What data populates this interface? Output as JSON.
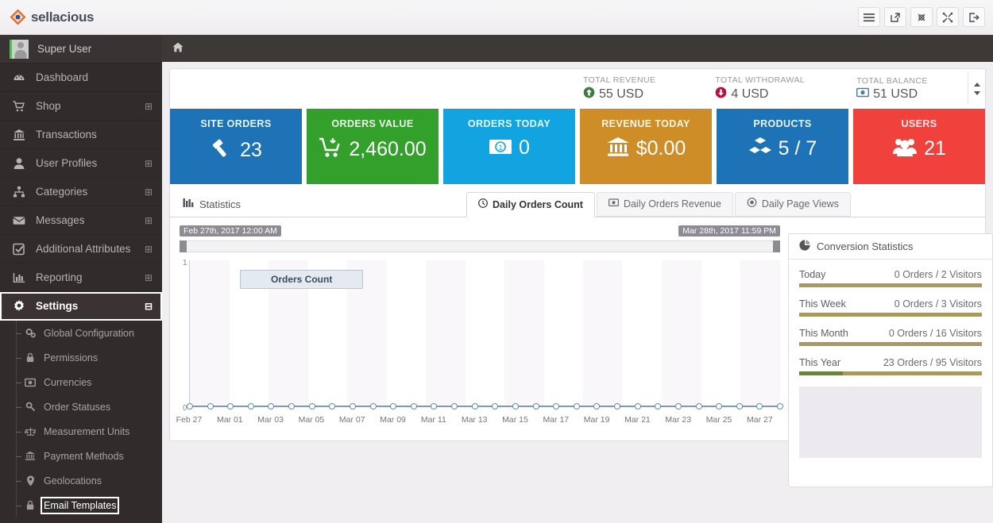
{
  "brand": {
    "name": "sellacious"
  },
  "topbar": {
    "icons": [
      {
        "name": "menu-toggle-icon",
        "glyph": "☰"
      },
      {
        "name": "preview-site-icon",
        "glyph": "↗"
      },
      {
        "name": "joomla-icon",
        "glyph": "❉"
      },
      {
        "name": "fullscreen-icon",
        "glyph": "⤢"
      },
      {
        "name": "logout-icon",
        "glyph": "→"
      }
    ]
  },
  "sidebar": {
    "user": "Super User",
    "items": [
      {
        "label": "Dashboard",
        "icon": "dashboard-icon",
        "expand": ""
      },
      {
        "label": "Shop",
        "icon": "cart-icon",
        "expand": "⊞"
      },
      {
        "label": "Transactions",
        "icon": "bank-icon",
        "expand": ""
      },
      {
        "label": "User Profiles",
        "icon": "user-icon",
        "expand": "⊞"
      },
      {
        "label": "Categories",
        "icon": "sitemap-icon",
        "expand": "⊞"
      },
      {
        "label": "Messages",
        "icon": "envelope-icon",
        "expand": "⊞"
      },
      {
        "label": "Additional Attributes",
        "icon": "checkbox-icon",
        "expand": "⊞"
      },
      {
        "label": "Reporting",
        "icon": "bar-chart-icon",
        "expand": "⊞"
      },
      {
        "label": "Settings",
        "icon": "gear-icon",
        "expand": "⊟",
        "active": true
      }
    ],
    "subitems": [
      {
        "label": "Global Configuration",
        "icon": "gears-icon"
      },
      {
        "label": "Permissions",
        "icon": "lock-icon"
      },
      {
        "label": "Currencies",
        "icon": "money-icon"
      },
      {
        "label": "Order Statuses",
        "icon": "wrench-icon"
      },
      {
        "label": "Measurement Units",
        "icon": "balance-scale-icon"
      },
      {
        "label": "Payment Methods",
        "icon": "bank-icon"
      },
      {
        "label": "Geolocations",
        "icon": "map-marker-icon"
      },
      {
        "label": "Email Templates",
        "icon": "lock-icon",
        "selected": true
      }
    ]
  },
  "breadcrumb": {
    "home_icon": "home-icon"
  },
  "summary": [
    {
      "label": "TOTAL REVENUE",
      "value": "55 USD",
      "icon": "arrow-up-circle-icon",
      "icon_color": "#3f7d3f"
    },
    {
      "label": "TOTAL WITHDRAWAL",
      "value": "4 USD",
      "icon": "arrow-down-circle-icon",
      "icon_color": "#b5123c"
    },
    {
      "label": "TOTAL BALANCE",
      "value": "51 USD",
      "icon": "money-icon",
      "icon_color": "#4a7fa5"
    }
  ],
  "summary_scroll_icon": "sort-updown-icon",
  "cards": [
    {
      "title": "SITE ORDERS",
      "value": "23",
      "icon": "gavel-icon",
      "glyph": "🔨",
      "color": "#1e73b7"
    },
    {
      "title": "ORDERS VALUE",
      "value": "2,460.00",
      "icon": "cart-arrow-down-icon",
      "glyph": "🛒",
      "color": "#33a02c"
    },
    {
      "title": "ORDERS TODAY",
      "value": "0",
      "icon": "money-bill-icon",
      "glyph": "💵",
      "color": "#12a4e0"
    },
    {
      "title": "REVENUE TODAY",
      "value": "$0.00",
      "icon": "bank-icon",
      "glyph": "🏛",
      "color": "#ce8d26"
    },
    {
      "title": "PRODUCTS",
      "value": "5 / 7",
      "icon": "cubes-icon",
      "glyph": "◧",
      "color": "#1e73b7"
    },
    {
      "title": "USERS",
      "value": "21",
      "icon": "users-icon",
      "glyph": "👥",
      "color": "#f0413c"
    }
  ],
  "statistics": {
    "panel_title": "Statistics",
    "panel_icon": "bar-chart-icon",
    "tabs": [
      {
        "label": "Daily Orders Count",
        "icon": "clock-icon",
        "active": true
      },
      {
        "label": "Daily Orders Revenue",
        "icon": "money-icon",
        "active": false
      },
      {
        "label": "Daily Page Views",
        "icon": "eye-icon",
        "active": false
      }
    ],
    "range_start": "Feb 27th, 2017 12:00 AM",
    "range_end": "Mar 28th, 2017 11:59 PM"
  },
  "chart_data": {
    "type": "line",
    "title": "",
    "legend": [
      "Orders Count"
    ],
    "legend_position": "inside-top-left",
    "xlabel": "",
    "ylabel": "",
    "ylim": [
      0,
      1
    ],
    "ytick_labels": [
      "1",
      "0"
    ],
    "grid": "alternating-vertical-bands",
    "x": [
      "Feb 27",
      "Feb 28",
      "Mar 01",
      "Mar 02",
      "Mar 03",
      "Mar 04",
      "Mar 05",
      "Mar 06",
      "Mar 07",
      "Mar 08",
      "Mar 09",
      "Mar 10",
      "Mar 11",
      "Mar 12",
      "Mar 13",
      "Mar 14",
      "Mar 15",
      "Mar 16",
      "Mar 17",
      "Mar 18",
      "Mar 19",
      "Mar 20",
      "Mar 21",
      "Mar 22",
      "Mar 23",
      "Mar 24",
      "Mar 25",
      "Mar 26",
      "Mar 27",
      "Mar 28"
    ],
    "xtick_labels": [
      "Feb 27",
      "Mar 01",
      "Mar 03",
      "Mar 05",
      "Mar 07",
      "Mar 09",
      "Mar 11",
      "Mar 13",
      "Mar 15",
      "Mar 17",
      "Mar 19",
      "Mar 21",
      "Mar 23",
      "Mar 25",
      "Mar 27"
    ],
    "series": [
      {
        "name": "Orders Count",
        "color": "#5b8db5",
        "values": [
          0,
          0,
          0,
          0,
          0,
          0,
          0,
          0,
          0,
          0,
          0,
          0,
          0,
          0,
          0,
          0,
          0,
          0,
          0,
          0,
          0,
          0,
          0,
          0,
          0,
          0,
          0,
          0,
          0,
          0
        ]
      }
    ]
  },
  "conversion": {
    "title": "Conversion Statistics",
    "icon": "pie-chart-icon",
    "rows": [
      {
        "label": "Today",
        "value": "0 Orders / 2 Visitors",
        "fill_pct": 0
      },
      {
        "label": "This Week",
        "value": "0 Orders / 3 Visitors",
        "fill_pct": 0
      },
      {
        "label": "This Month",
        "value": "0 Orders / 16 Visitors",
        "fill_pct": 0
      },
      {
        "label": "This Year",
        "value": "23 Orders / 95 Visitors",
        "fill_pct": 24
      }
    ]
  }
}
